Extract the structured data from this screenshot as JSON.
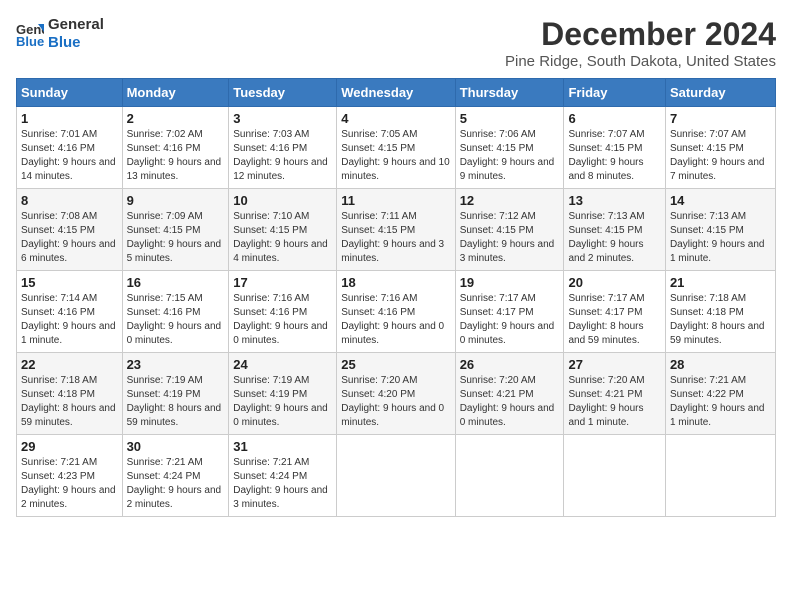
{
  "logo": {
    "line1": "General",
    "line2": "Blue"
  },
  "title": "December 2024",
  "subtitle": "Pine Ridge, South Dakota, United States",
  "days_header": [
    "Sunday",
    "Monday",
    "Tuesday",
    "Wednesday",
    "Thursday",
    "Friday",
    "Saturday"
  ],
  "weeks": [
    [
      {
        "num": "1",
        "sunrise": "7:01 AM",
        "sunset": "4:16 PM",
        "daylight": "9 hours and 14 minutes."
      },
      {
        "num": "2",
        "sunrise": "7:02 AM",
        "sunset": "4:16 PM",
        "daylight": "9 hours and 13 minutes."
      },
      {
        "num": "3",
        "sunrise": "7:03 AM",
        "sunset": "4:16 PM",
        "daylight": "9 hours and 12 minutes."
      },
      {
        "num": "4",
        "sunrise": "7:05 AM",
        "sunset": "4:15 PM",
        "daylight": "9 hours and 10 minutes."
      },
      {
        "num": "5",
        "sunrise": "7:06 AM",
        "sunset": "4:15 PM",
        "daylight": "9 hours and 9 minutes."
      },
      {
        "num": "6",
        "sunrise": "7:07 AM",
        "sunset": "4:15 PM",
        "daylight": "9 hours and 8 minutes."
      },
      {
        "num": "7",
        "sunrise": "7:07 AM",
        "sunset": "4:15 PM",
        "daylight": "9 hours and 7 minutes."
      }
    ],
    [
      {
        "num": "8",
        "sunrise": "7:08 AM",
        "sunset": "4:15 PM",
        "daylight": "9 hours and 6 minutes."
      },
      {
        "num": "9",
        "sunrise": "7:09 AM",
        "sunset": "4:15 PM",
        "daylight": "9 hours and 5 minutes."
      },
      {
        "num": "10",
        "sunrise": "7:10 AM",
        "sunset": "4:15 PM",
        "daylight": "9 hours and 4 minutes."
      },
      {
        "num": "11",
        "sunrise": "7:11 AM",
        "sunset": "4:15 PM",
        "daylight": "9 hours and 3 minutes."
      },
      {
        "num": "12",
        "sunrise": "7:12 AM",
        "sunset": "4:15 PM",
        "daylight": "9 hours and 3 minutes."
      },
      {
        "num": "13",
        "sunrise": "7:13 AM",
        "sunset": "4:15 PM",
        "daylight": "9 hours and 2 minutes."
      },
      {
        "num": "14",
        "sunrise": "7:13 AM",
        "sunset": "4:15 PM",
        "daylight": "9 hours and 1 minute."
      }
    ],
    [
      {
        "num": "15",
        "sunrise": "7:14 AM",
        "sunset": "4:16 PM",
        "daylight": "9 hours and 1 minute."
      },
      {
        "num": "16",
        "sunrise": "7:15 AM",
        "sunset": "4:16 PM",
        "daylight": "9 hours and 0 minutes."
      },
      {
        "num": "17",
        "sunrise": "7:16 AM",
        "sunset": "4:16 PM",
        "daylight": "9 hours and 0 minutes."
      },
      {
        "num": "18",
        "sunrise": "7:16 AM",
        "sunset": "4:16 PM",
        "daylight": "9 hours and 0 minutes."
      },
      {
        "num": "19",
        "sunrise": "7:17 AM",
        "sunset": "4:17 PM",
        "daylight": "9 hours and 0 minutes."
      },
      {
        "num": "20",
        "sunrise": "7:17 AM",
        "sunset": "4:17 PM",
        "daylight": "8 hours and 59 minutes."
      },
      {
        "num": "21",
        "sunrise": "7:18 AM",
        "sunset": "4:18 PM",
        "daylight": "8 hours and 59 minutes."
      }
    ],
    [
      {
        "num": "22",
        "sunrise": "7:18 AM",
        "sunset": "4:18 PM",
        "daylight": "8 hours and 59 minutes."
      },
      {
        "num": "23",
        "sunrise": "7:19 AM",
        "sunset": "4:19 PM",
        "daylight": "8 hours and 59 minutes."
      },
      {
        "num": "24",
        "sunrise": "7:19 AM",
        "sunset": "4:19 PM",
        "daylight": "9 hours and 0 minutes."
      },
      {
        "num": "25",
        "sunrise": "7:20 AM",
        "sunset": "4:20 PM",
        "daylight": "9 hours and 0 minutes."
      },
      {
        "num": "26",
        "sunrise": "7:20 AM",
        "sunset": "4:21 PM",
        "daylight": "9 hours and 0 minutes."
      },
      {
        "num": "27",
        "sunrise": "7:20 AM",
        "sunset": "4:21 PM",
        "daylight": "9 hours and 1 minute."
      },
      {
        "num": "28",
        "sunrise": "7:21 AM",
        "sunset": "4:22 PM",
        "daylight": "9 hours and 1 minute."
      }
    ],
    [
      {
        "num": "29",
        "sunrise": "7:21 AM",
        "sunset": "4:23 PM",
        "daylight": "9 hours and 2 minutes."
      },
      {
        "num": "30",
        "sunrise": "7:21 AM",
        "sunset": "4:24 PM",
        "daylight": "9 hours and 2 minutes."
      },
      {
        "num": "31",
        "sunrise": "7:21 AM",
        "sunset": "4:24 PM",
        "daylight": "9 hours and 3 minutes."
      },
      null,
      null,
      null,
      null
    ]
  ]
}
